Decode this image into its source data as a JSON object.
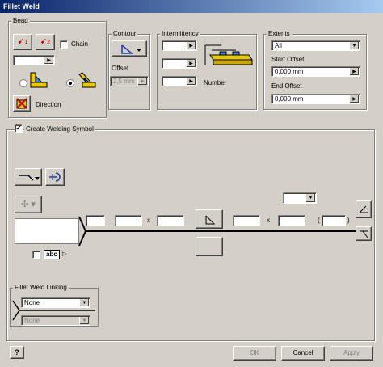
{
  "window": {
    "title": "Fillet Weld"
  },
  "bead": {
    "group_label": "Bead",
    "btn1_label": "1",
    "btn2_label": "2",
    "chain_label": "Chain",
    "direction_label": "Direction",
    "dropdown_value": ""
  },
  "contour": {
    "group_label": "Contour",
    "offset_label": "Offset",
    "offset_value": "2,5 mm"
  },
  "intermittency": {
    "group_label": "Intermittency",
    "number_label": "Number",
    "fields": [
      "",
      "",
      ""
    ]
  },
  "extents": {
    "group_label": "Extents",
    "type_value": "All",
    "start_offset_label": "Start Offset",
    "start_offset_value": "0,000 mm",
    "end_offset_label": "End Offset",
    "end_offset_value": "0,000 mm"
  },
  "welding_symbol": {
    "checkbox_label": "Create Welding Symbol",
    "checked": true,
    "x1": "x",
    "x2": "x",
    "paren_open": "(",
    "paren_close": ")",
    "abc_label": "abc",
    "top_dropdown_value": ""
  },
  "linking": {
    "group_label": "Fillet Weld Linking",
    "value1": "None",
    "value2": "None"
  },
  "footer": {
    "help": "?",
    "ok": "OK",
    "cancel": "Cancel",
    "apply": "Apply"
  }
}
